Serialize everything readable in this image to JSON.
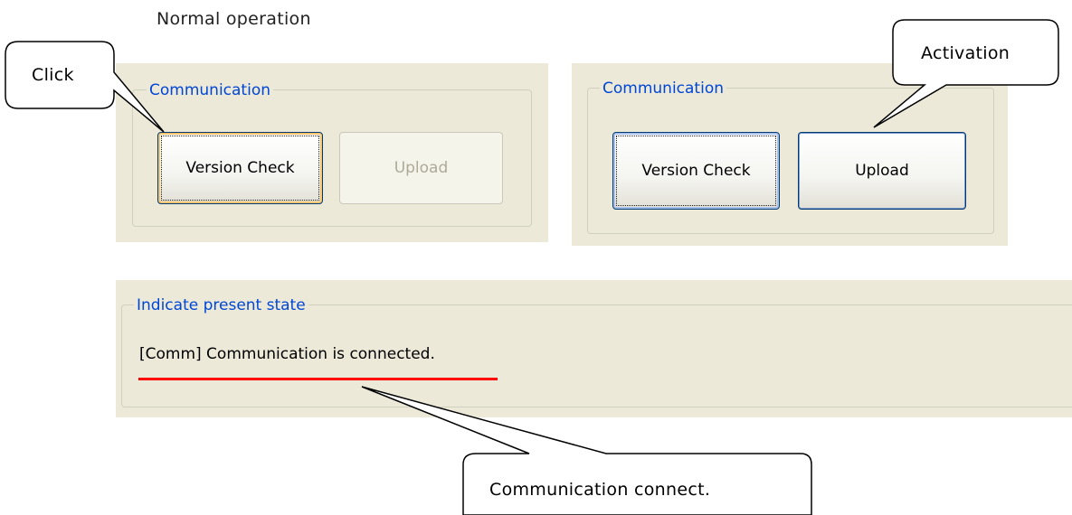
{
  "heading": "Normal operation",
  "left_panel": {
    "group_title": "Communication",
    "version_check_label": "Version Check",
    "upload_label": "Upload",
    "upload_state": "disabled"
  },
  "right_panel": {
    "group_title": "Communication",
    "version_check_label": "Version Check",
    "upload_label": "Upload",
    "upload_state": "enabled"
  },
  "status_panel": {
    "group_title": "Indicate present state",
    "message": "[Comm] Communication is connected."
  },
  "callouts": {
    "click": "Click",
    "activation": "Activation",
    "connect": "Communication connect."
  },
  "colors": {
    "panel_bg": "#ece9d8",
    "group_title": "#0046d5",
    "underline": "#ff0000"
  }
}
